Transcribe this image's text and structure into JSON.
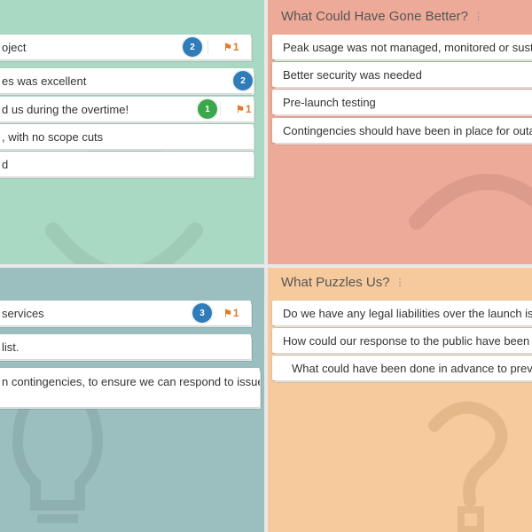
{
  "quadrants": {
    "went_well": {
      "cards": [
        {
          "text": "oject",
          "votes": "2",
          "flags": "1"
        },
        {
          "text": "es was excellent",
          "votes": "2"
        },
        {
          "text": "d us during the overtime!",
          "votes": "1",
          "flags": "1"
        },
        {
          "text": ", with no scope cuts"
        },
        {
          "text": "d"
        }
      ]
    },
    "gone_better": {
      "title": "What Could Have Gone Better?",
      "cards": [
        {
          "text": "Peak usage was not managed, monitored or sustained"
        },
        {
          "text": "Better security was needed"
        },
        {
          "text": "Pre-launch testing"
        },
        {
          "text": "Contingencies should have been in place for outages"
        }
      ]
    },
    "ideas": {
      "cards": [
        {
          "text": " services",
          "votes": "3",
          "flags": "1"
        },
        {
          "text": "list."
        },
        {
          "text": "n contingencies, to ensure we can respond to issues"
        }
      ]
    },
    "puzzles": {
      "title": "What Puzzles Us?",
      "cards": [
        {
          "text": "Do we have any legal liabilities over the launch issues?"
        },
        {
          "text": "How could our response to the public have been better?"
        },
        {
          "text": "What could have been done in advance to prevent"
        }
      ]
    }
  },
  "icons": {
    "grip": "vertical-dots-icon",
    "flag": "flag-icon"
  },
  "colors": {
    "went_well_bg": "#a9d9c3",
    "gone_better_bg": "#eeaa98",
    "ideas_bg": "#9abfbe",
    "puzzles_bg": "#f6ca9c",
    "vote_blue": "#2f7cb9",
    "vote_green": "#3aa84a",
    "flag_orange": "#e07b2a"
  }
}
